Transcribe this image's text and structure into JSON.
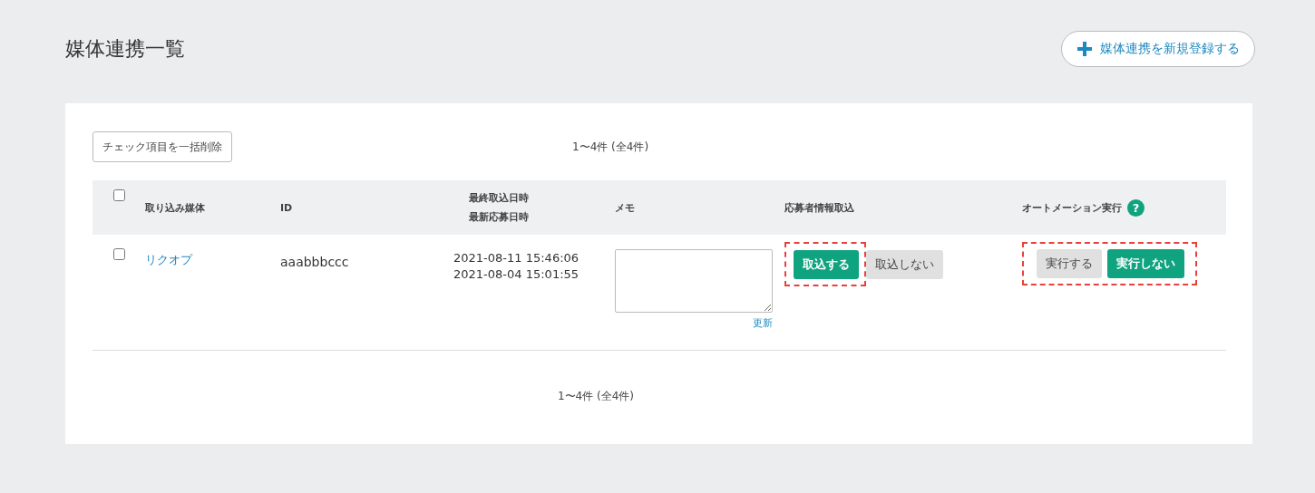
{
  "page": {
    "title": "媒体連携一覧"
  },
  "add_button": {
    "label": "媒体連携を新規登録する"
  },
  "bulk_delete_button": {
    "label": "チェック項目を一括削除"
  },
  "pagination_top": "1〜4件 (全4件)",
  "table": {
    "select_all_checked": false,
    "columns": [
      {
        "kind": "text",
        "lines": [
          "取り込み媒体"
        ]
      },
      {
        "kind": "text",
        "lines": [
          "ID"
        ]
      },
      {
        "kind": "text",
        "lines": [
          "最終取込日時",
          "最新応募日時"
        ]
      },
      {
        "kind": "text",
        "lines": [
          "メモ"
        ]
      },
      {
        "kind": "text",
        "lines": [
          "応募者情報取込"
        ]
      },
      {
        "kind": "help",
        "lines": [
          "オートメーション実行"
        ],
        "help_icon": "?"
      }
    ],
    "rows": [
      {
        "checked": false,
        "media": "リクオプ",
        "id": "aaabbbccc",
        "dates": [
          "2021-08-11 15:46:06",
          "2021-08-04 15:01:55"
        ],
        "update_link": "更新",
        "import_highlighted": true,
        "import_options": [
          {
            "label": "取込する",
            "selected": true
          },
          {
            "label": "取込しない",
            "selected": false
          }
        ],
        "automation_highlighted": true,
        "automation_options": [
          {
            "label": "実行する",
            "selected": false
          },
          {
            "label": "実行しない",
            "selected": true
          }
        ]
      }
    ]
  },
  "pagination_bottom": "1〜4件 (全4件)"
}
